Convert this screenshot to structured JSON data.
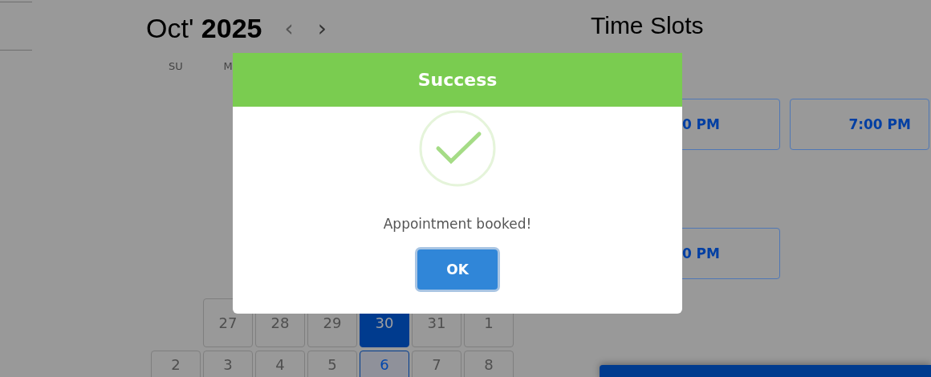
{
  "calendar": {
    "title": "Oct' **2025**",
    "prev": "‹",
    "next": "›",
    "weekdays": [
      "SU",
      "M"
    ],
    "weeks": [
      {
        "lead_blank": true,
        "days": [
          {
            "day": "27",
            "selected": false,
            "today": false
          },
          {
            "day": "28",
            "selected": false,
            "today": false
          },
          {
            "day": "29",
            "selected": false,
            "today": false
          },
          {
            "day": "30",
            "selected": true,
            "today": false
          },
          {
            "day": "31",
            "selected": false,
            "today": false
          },
          {
            "day": "1",
            "selected": false,
            "today": false
          }
        ]
      },
      {
        "lead_blank": false,
        "days": [
          {
            "day": "2",
            "selected": false,
            "today": false
          },
          {
            "day": "3",
            "selected": false,
            "today": false
          },
          {
            "day": "4",
            "selected": false,
            "today": false
          },
          {
            "day": "5",
            "selected": false,
            "today": false
          },
          {
            "day": "6",
            "selected": false,
            "today": true
          },
          {
            "day": "7",
            "selected": false,
            "today": false
          },
          {
            "day": "8",
            "selected": false,
            "today": false
          }
        ]
      }
    ]
  },
  "time_slots": {
    "title": "Time Slots",
    "slots": [
      {
        "label": "0 PM"
      },
      {
        "label": "7:00 PM"
      },
      {
        "label": "0 PM"
      }
    ]
  },
  "dialog": {
    "title": "Success",
    "message": "Appointment booked!",
    "button": "OK"
  }
}
